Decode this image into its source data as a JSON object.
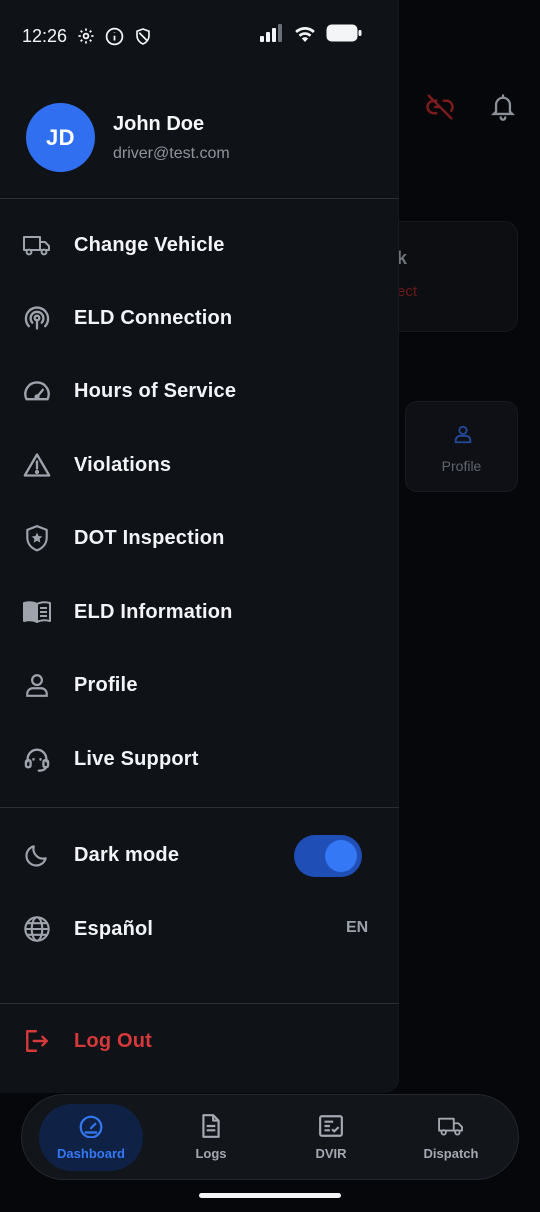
{
  "status_bar": {
    "time": "12:26"
  },
  "background": {
    "card_title": "k",
    "card_subtitle": "ect",
    "tile_label": "Profile"
  },
  "user": {
    "initials": "JD",
    "name": "John Doe",
    "email": "driver@test.com"
  },
  "menu": [
    {
      "label": "Change Vehicle",
      "icon": "truck-icon"
    },
    {
      "label": "ELD Connection",
      "icon": "signal-icon"
    },
    {
      "label": "Hours of Service",
      "icon": "speedometer-icon"
    },
    {
      "label": "Violations",
      "icon": "warning-icon"
    },
    {
      "label": "DOT Inspection",
      "icon": "shield-star-icon"
    },
    {
      "label": "ELD Information",
      "icon": "book-icon"
    },
    {
      "label": "Profile",
      "icon": "person-icon"
    },
    {
      "label": "Live Support",
      "icon": "headset-icon"
    }
  ],
  "settings": {
    "dark_mode_label": "Dark mode",
    "dark_mode_on": true,
    "language_label": "Español",
    "language_code": "EN"
  },
  "logout": {
    "label": "Log Out",
    "color": "#d6393a"
  },
  "bottom_nav": [
    {
      "label": "Dashboard",
      "active": true
    },
    {
      "label": "Logs",
      "active": false
    },
    {
      "label": "DVIR",
      "active": false
    },
    {
      "label": "Dispatch",
      "active": false
    }
  ],
  "colors": {
    "accent": "#3478f6",
    "drawer_bg": "#0f1217",
    "danger": "#d6393a"
  }
}
